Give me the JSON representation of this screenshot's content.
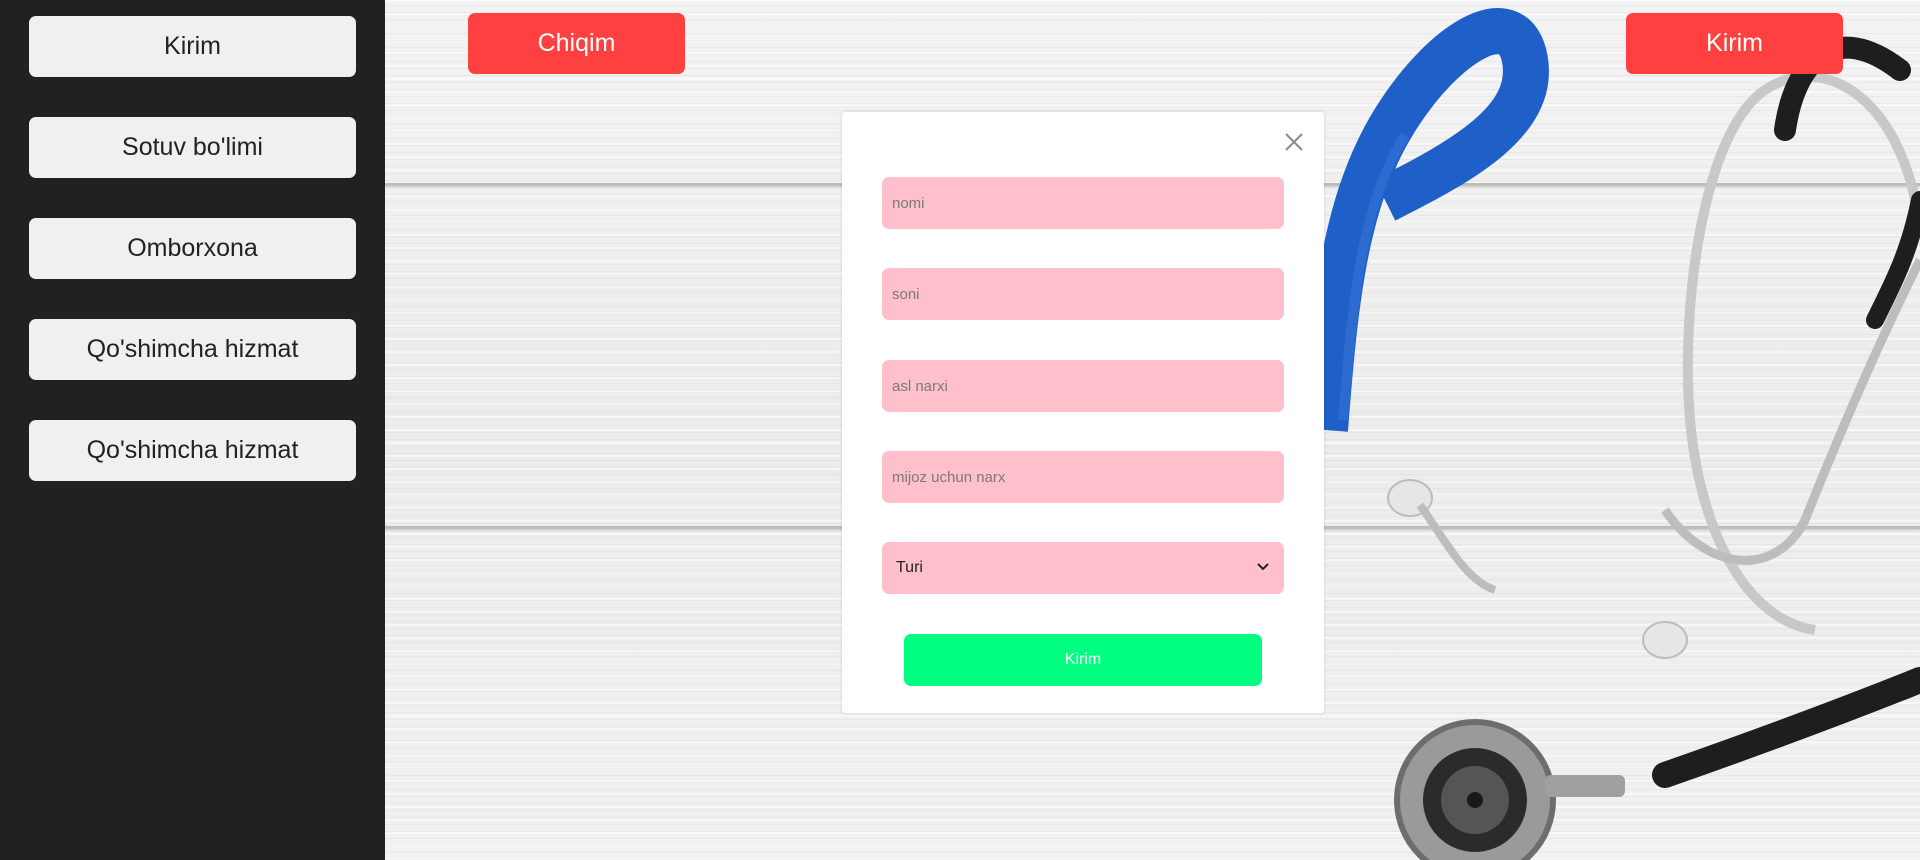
{
  "sidebar": {
    "items": [
      {
        "label": "Kirim"
      },
      {
        "label": "Sotuv bo'limi"
      },
      {
        "label": "Omborxona"
      },
      {
        "label": "Qo'shimcha hizmat"
      },
      {
        "label": "Qo'shimcha hizmat"
      }
    ]
  },
  "header": {
    "chiqim_label": "Chiqim",
    "kirim_label": "Kirim"
  },
  "modal": {
    "fields": [
      {
        "placeholder": "nomi",
        "value": ""
      },
      {
        "placeholder": "soni",
        "value": ""
      },
      {
        "placeholder": "asl narxi",
        "value": ""
      },
      {
        "placeholder": "mijoz uchun narx",
        "value": ""
      }
    ],
    "type_select": {
      "selected": "Turi"
    },
    "submit_label": "Kirim",
    "close_icon": "close-icon"
  },
  "colors": {
    "sidebar_bg": "#212121",
    "sidebar_button": "#f0f0f0",
    "red_button": "#ff4040",
    "field_bg": "#ffc0cb",
    "submit_bg": "#00ff80",
    "ribbon": "#1f5fc8"
  }
}
